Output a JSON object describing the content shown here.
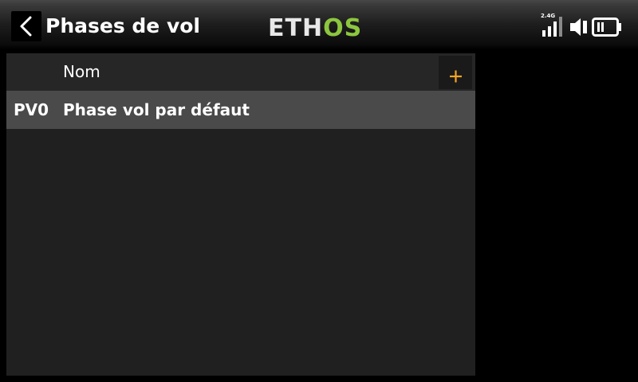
{
  "header": {
    "title": "Phases de vol",
    "logo": {
      "part1": "ETH",
      "part2": "OS",
      "color1": "#e8e8e8",
      "color2": "#8dc63f"
    },
    "back_icon": "chevron-left-icon"
  },
  "status": {
    "band": "2.4G",
    "signal_icon": "signal-bars-icon",
    "volume_icon": "speaker-icon",
    "battery_icon": "battery-icon"
  },
  "table": {
    "column_name": "Nom",
    "add_icon": "plus-icon",
    "rows": [
      {
        "id": "PV0",
        "name": "Phase vol par défaut"
      }
    ]
  },
  "colors": {
    "accent": "#f5a623",
    "logo_green": "#8dc63f",
    "panel_bg": "#202020",
    "selected_row": "#4a4a4a"
  }
}
